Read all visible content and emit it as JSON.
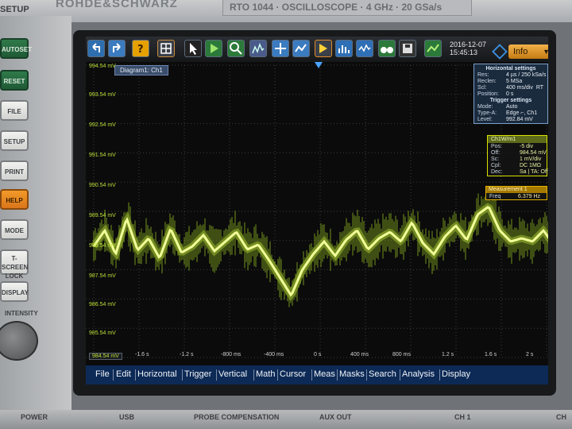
{
  "device": {
    "brand": "ROHDE&SCHWARZ",
    "model": "RTO 1044 · OSCILLOSCOPE · 4 GHz · 20 GSa/s",
    "setup_label": "SETUP",
    "buttons": [
      "AUTOSET",
      "RESET",
      "FILE",
      "SETUP",
      "PRINT",
      "HELP",
      "MODE",
      "T-SCREEN LOCK",
      "DISPLAY"
    ],
    "intensity_label": "INTENSITY",
    "port_labels": [
      "POWER",
      "USB",
      "PROBE COMPENSATION",
      "AUX OUT",
      "CH 1",
      "CH"
    ]
  },
  "toolbar": {
    "date": "2016-12-07",
    "time": "15:45:13",
    "info_select": "Info",
    "icons": [
      "undo-icon",
      "redo-icon",
      "help-icon",
      "grid-icon",
      "pointer-icon",
      "run-icon",
      "zoom-icon",
      "fft-icon",
      "cursor-icon",
      "measure-icon",
      "trigger-icon",
      "histogram-icon",
      "mask-icon",
      "binoculars-icon",
      "save-icon",
      "screenshot-icon"
    ]
  },
  "diagram": {
    "tab": "Diagram1: Ch1",
    "y_labels": [
      "994.54 mV",
      "993.54 mV",
      "992.54 mV",
      "991.54 mV",
      "990.54 mV",
      "989.54 mV",
      "988.54 mV",
      "987.54 mV",
      "986.54 mV",
      "985.54 mV"
    ],
    "x_start": "984.54 mV",
    "x_labels": [
      "-1.6 s",
      "-1.2 s",
      "-800 ms",
      "-400 ms",
      "0 s",
      "400 ms",
      "800 ms",
      "1.2 s",
      "1.6 s",
      "2 s"
    ]
  },
  "horizontal": {
    "title": "Horizontal settings",
    "rows": [
      {
        "k": "Res:",
        "v": "4 µs / 250 kSa/s"
      },
      {
        "k": "Reclen:",
        "v": "5 MSa"
      },
      {
        "k": "Scl:",
        "v": "400 ms/div"
      },
      {
        "k": "Position:",
        "v": "0 s"
      }
    ],
    "badge": "RT"
  },
  "trigger": {
    "title": "Trigger settings",
    "rows": [
      {
        "k": "Mode:",
        "v": "Auto"
      },
      {
        "k": "Type-A:",
        "v": "Edge ⌐, Ch1"
      },
      {
        "k": "Level:",
        "v": "992.84 mV"
      }
    ]
  },
  "channel": {
    "title": "Ch1W/m1",
    "rows": [
      {
        "k": "Pos:",
        "v": "-5 div"
      },
      {
        "k": "Off:",
        "v": "984.54 mV"
      },
      {
        "k": "Sc:",
        "v": "1 mV/div"
      },
      {
        "k": "Cpl:",
        "v": "DC 1MΩ"
      },
      {
        "k": "Dec:",
        "v": "Sa | TA: Off"
      }
    ]
  },
  "measurement": {
    "title": "Measurement 1",
    "label": "Freq",
    "value": "6.379 Hz"
  },
  "menu": [
    "File",
    "Edit",
    "Horizontal",
    "Trigger",
    "Vertical",
    "Math",
    "Cursor",
    "Meas",
    "Masks",
    "Search",
    "Analysis",
    "Display"
  ],
  "colors": {
    "trace": "#d8ff3a",
    "menu_bg": "#0d2a56",
    "info_accent": "#e3a02a"
  }
}
